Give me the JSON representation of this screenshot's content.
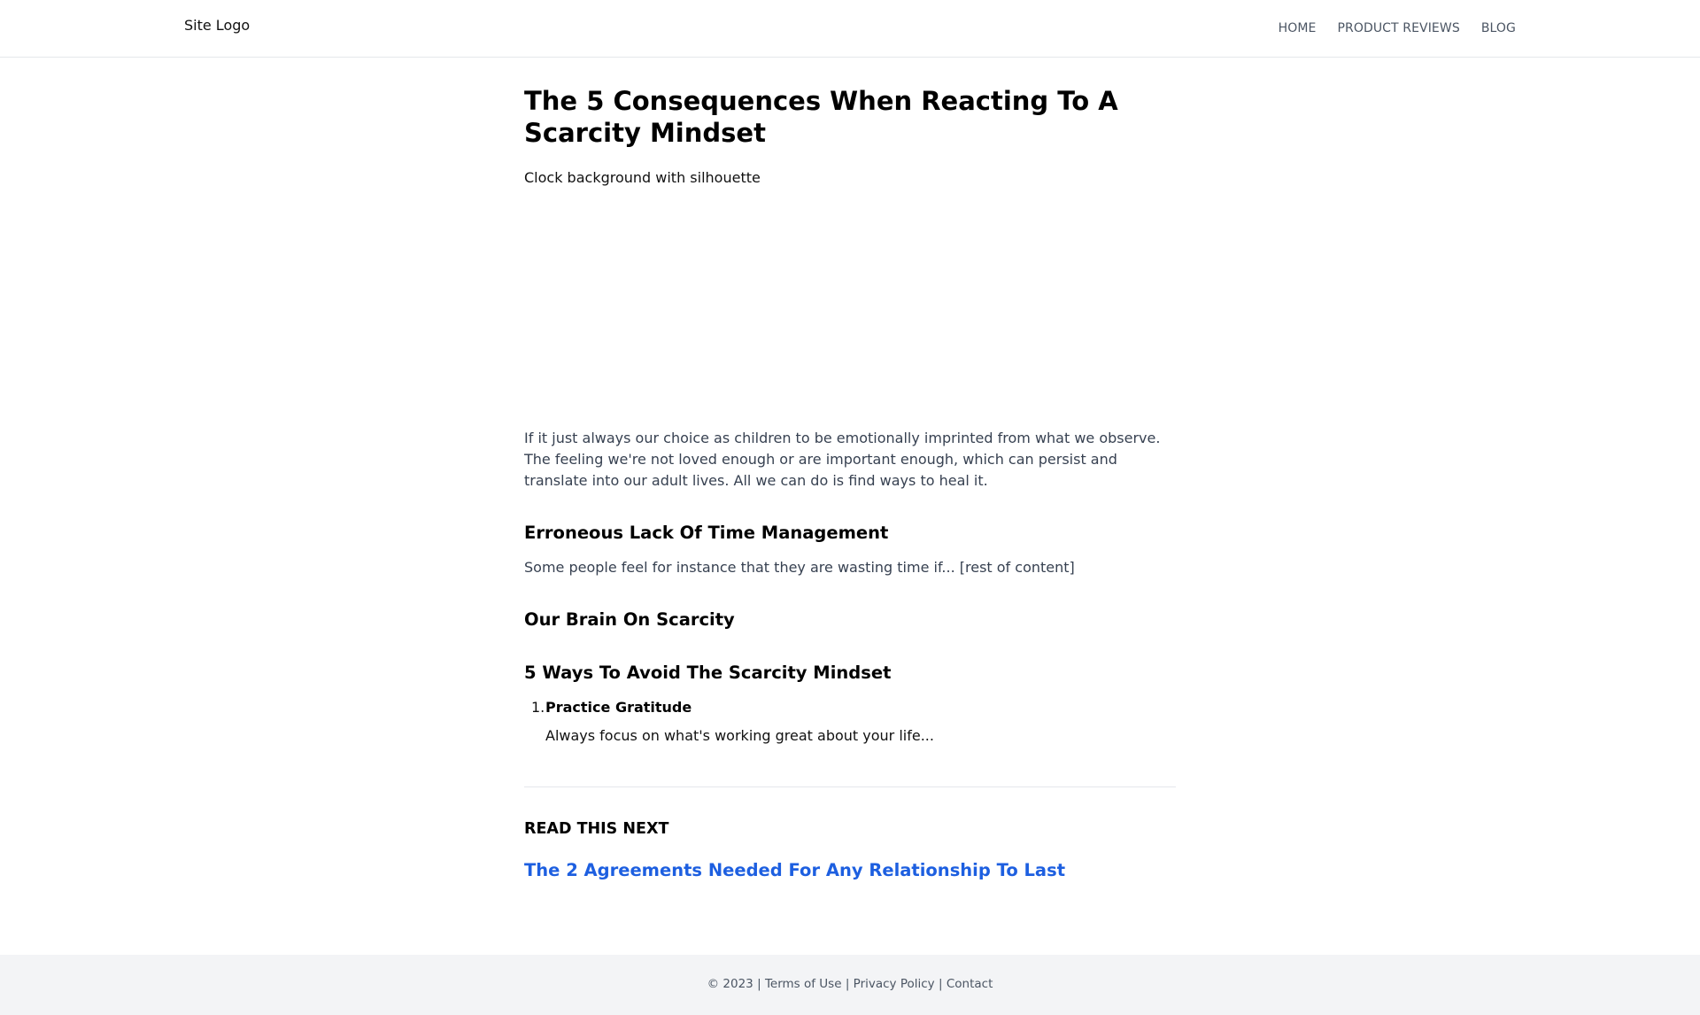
{
  "header": {
    "logo": "Site Logo",
    "nav": [
      "HOME",
      "PRODUCT REVIEWS",
      "BLOG"
    ]
  },
  "article": {
    "title": "The 5 Consequences When Reacting To A Scarcity Mindset",
    "image_alt": "Clock background with silhouette",
    "intro": "If it just always our choice as children to be emotionally imprinted from what we observe. The feeling we're not loved enough or are important enough, which can persist and translate into our adult lives. All we can do is find ways to heal it.",
    "sections": [
      {
        "heading": "Erroneous Lack Of Time Management",
        "text": "Some people feel for instance that they are wasting time if... [rest of content]"
      },
      {
        "heading": "Our Brain On Scarcity"
      },
      {
        "heading": "5 Ways To Avoid The Scarcity Mindset"
      }
    ],
    "list": [
      {
        "number": "1.",
        "title": "Practice Gratitude",
        "text": "Always focus on what's working great about your life..."
      }
    ],
    "read_next": {
      "label": "READ THIS NEXT",
      "link_text": "The 2 Agreements Needed For Any Relationship To Last"
    }
  },
  "footer": {
    "copyright": "© 2023",
    "separator": "|",
    "links": [
      "Terms of Use",
      "Privacy Policy",
      "Contact"
    ]
  },
  "colors": {
    "link_blue": "#1d5fe0",
    "footer_bg": "#f3f4f6",
    "body_text": "#374151"
  }
}
